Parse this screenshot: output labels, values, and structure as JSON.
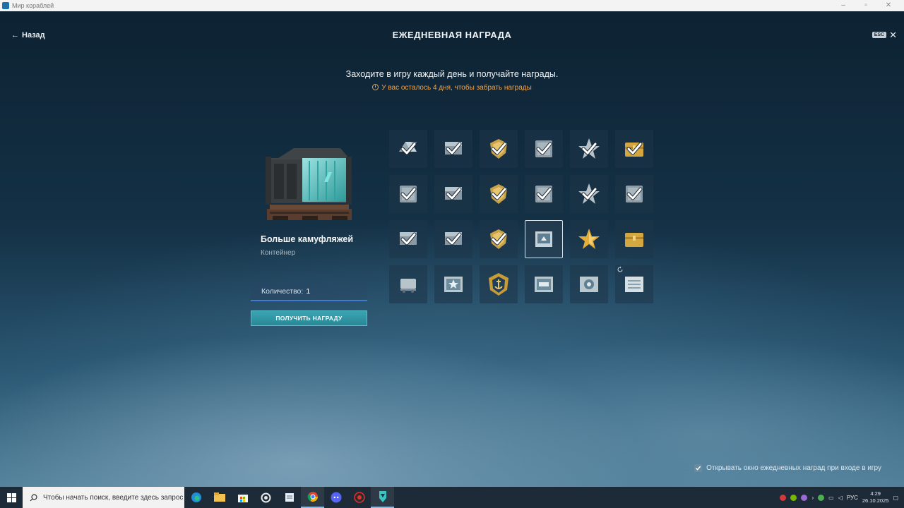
{
  "window": {
    "title": "Мир кораблей"
  },
  "header": {
    "back_label": "Назад",
    "title": "ЕЖЕДНЕВНАЯ НАГРАДА",
    "esc_label": "ESC"
  },
  "intro": {
    "subtitle": "Заходите в игру каждый день и получайте награды.",
    "deadline": "У вас осталось 4 дня, чтобы забрать награды"
  },
  "reward": {
    "name": "Больше камуфляжей",
    "type": "Контейнер",
    "quantity_label": "Количество:",
    "quantity_value": "1",
    "claim_label": "ПОЛУЧИТЬ НАГРАДУ"
  },
  "grid": {
    "rows": [
      [
        {
          "icon": "ribbon-icon",
          "claimed": true
        },
        {
          "icon": "flag-icon",
          "claimed": true
        },
        {
          "icon": "gold-emblem-icon",
          "claimed": true
        },
        {
          "icon": "camo-icon",
          "claimed": true
        },
        {
          "icon": "silver-star-icon",
          "claimed": true
        },
        {
          "icon": "gold-chest-icon",
          "claimed": true
        }
      ],
      [
        {
          "icon": "camo-icon",
          "claimed": true
        },
        {
          "icon": "flag-icon",
          "claimed": true
        },
        {
          "icon": "gold-emblem-icon",
          "claimed": true
        },
        {
          "icon": "camo-icon",
          "claimed": true
        },
        {
          "icon": "silver-star-icon",
          "claimed": true
        },
        {
          "icon": "camo-icon",
          "claimed": true
        }
      ],
      [
        {
          "icon": "flag-icon",
          "claimed": true
        },
        {
          "icon": "flag-icon",
          "claimed": true
        },
        {
          "icon": "gold-emblem-icon",
          "claimed": true
        },
        {
          "icon": "container-card-icon",
          "claimed": false,
          "selected": true
        },
        {
          "icon": "gold-star-icon",
          "claimed": false
        },
        {
          "icon": "gold-chest-icon",
          "claimed": false
        }
      ],
      [
        {
          "icon": "supply-container-icon",
          "claimed": false
        },
        {
          "icon": "star-card-icon",
          "claimed": false
        },
        {
          "icon": "anchor-emblem-icon",
          "claimed": false
        },
        {
          "icon": "ship-card-icon",
          "claimed": false
        },
        {
          "icon": "special-card-icon",
          "claimed": false
        },
        {
          "icon": "document-card-icon",
          "claimed": false
        }
      ]
    ]
  },
  "footer": {
    "auto_open_label": "Открывать окно ежедневных наград при входе в игру",
    "auto_open_checked": true
  },
  "taskbar": {
    "search_placeholder": "Чтобы начать поиск, введите здесь запрос",
    "language": "РУС",
    "time": "4:29",
    "date": "26.10.2025"
  },
  "colors": {
    "accent_orange": "#f0a44c",
    "claim_button": "#2f93a2",
    "quantity_underline": "#3f7bd1"
  }
}
